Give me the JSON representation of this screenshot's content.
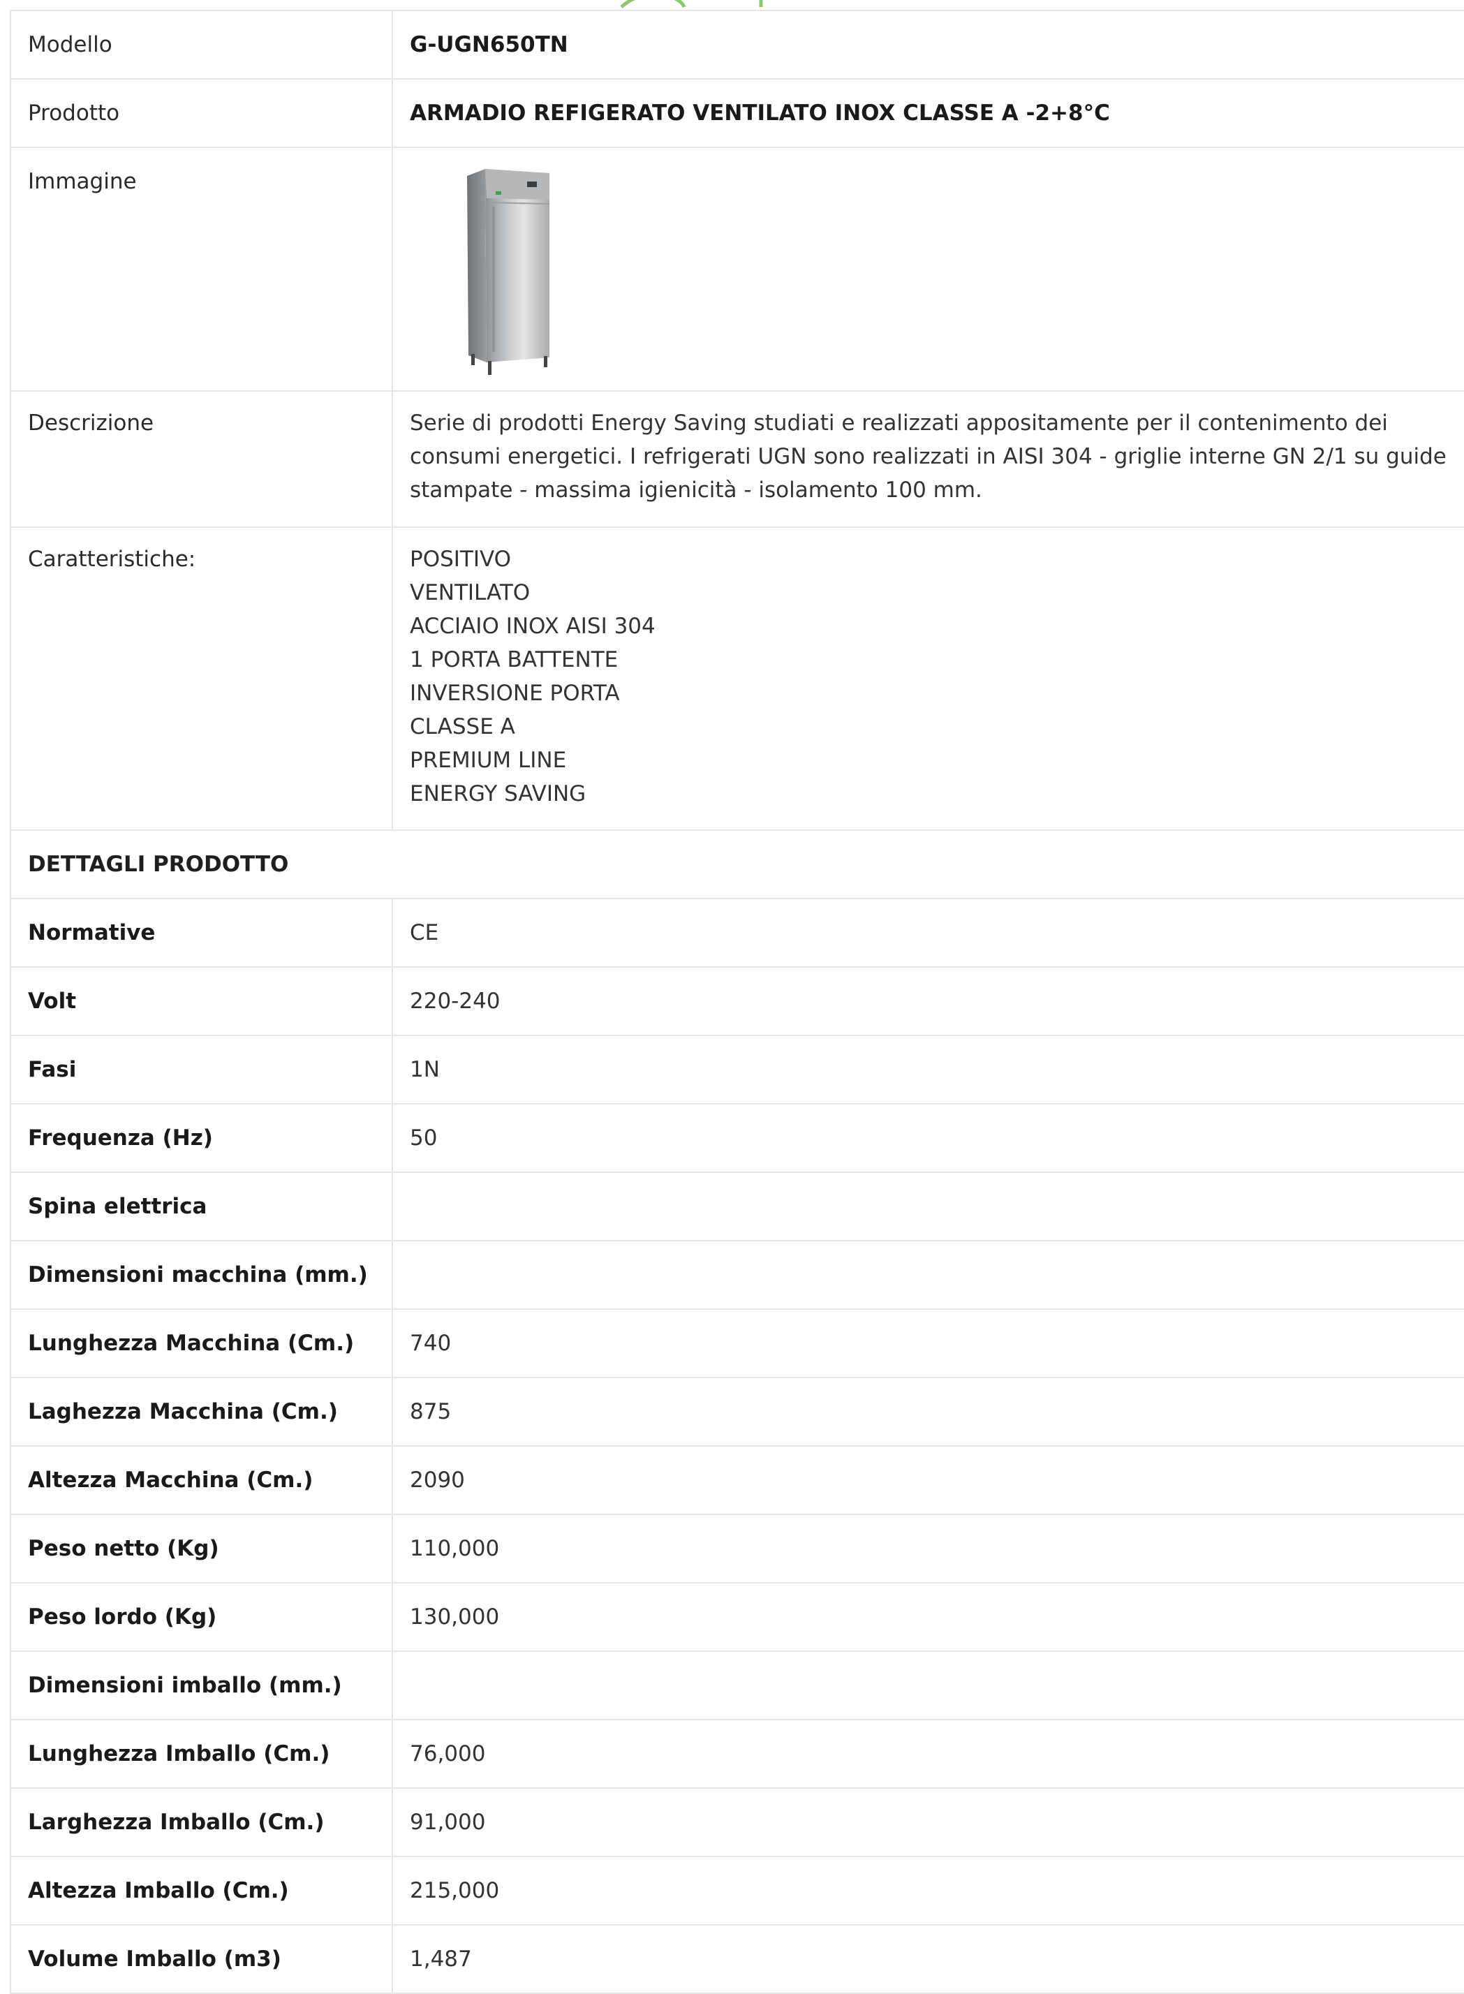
{
  "header_rows": [
    {
      "label": "Modello",
      "value": "G-UGN650TN"
    },
    {
      "label": "Prodotto",
      "value": "ARMADIO REFIGERATO VENTILATO INOX CLASSE A -2+8°C"
    }
  ],
  "image_row": {
    "label": "Immagine",
    "image": "stainless-steel-refrigerator-cabinet"
  },
  "description_row": {
    "label": "Descrizione",
    "value": "Serie di prodotti Energy Saving studiati e realizzati appositamente per il contenimento dei consumi energetici. I refrigerati UGN sono realizzati in AISI 304 - griglie interne GN 2/1 su guide stampate - massima igienicità - isolamento 100 mm."
  },
  "features_row": {
    "label": "Caratteristiche:",
    "items": [
      "POSITIVO",
      "VENTILATO",
      "ACCIAIO INOX AISI 304",
      "1 PORTA BATTENTE",
      "INVERSIONE PORTA",
      "CLASSE A",
      "PREMIUM LINE",
      "ENERGY SAVING"
    ]
  },
  "details_section": {
    "title": "DETTAGLI PRODOTTO"
  },
  "details": [
    {
      "label": "Normative",
      "value": "CE"
    },
    {
      "label": "Volt",
      "value": "220-240"
    },
    {
      "label": "Fasi",
      "value": "1N"
    },
    {
      "label": "Frequenza (Hz)",
      "value": "50"
    },
    {
      "label": "Spina elettrica",
      "value": ""
    },
    {
      "label": "Dimensioni macchina (mm.)",
      "value": ""
    },
    {
      "label": "Lunghezza Macchina (Cm.)",
      "value": "740"
    },
    {
      "label": "Laghezza Macchina (Cm.)",
      "value": "875"
    },
    {
      "label": "Altezza Macchina (Cm.)",
      "value": "2090"
    },
    {
      "label": "Peso netto (Kg)",
      "value": "110,000"
    },
    {
      "label": "Peso lordo (Kg)",
      "value": "130,000"
    },
    {
      "label": "Dimensioni imballo (mm.)",
      "value": ""
    },
    {
      "label": "Lunghezza Imballo (Cm.)",
      "value": "76,000"
    },
    {
      "label": "Larghezza Imballo (Cm.)",
      "value": "91,000"
    },
    {
      "label": "Altezza Imballo (Cm.)",
      "value": "215,000"
    },
    {
      "label": "Volume Imballo (m3)",
      "value": "1,487"
    }
  ],
  "colors": {
    "logo_green": "#8cc86a",
    "border": "#e6e6e6"
  }
}
